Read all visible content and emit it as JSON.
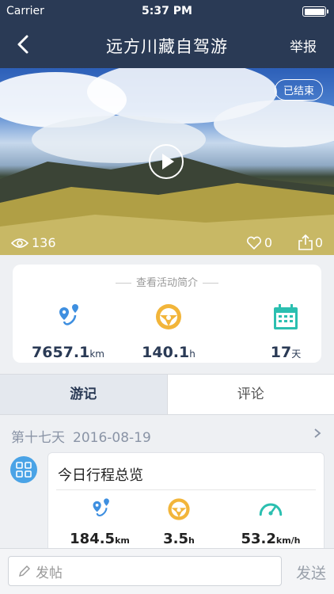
{
  "status": {
    "carrier": "Carrier",
    "time": "5:37 PM"
  },
  "nav": {
    "title": "远方川藏自驾游",
    "report": "举报"
  },
  "hero": {
    "badge": "已结束",
    "views": "136",
    "likes": "0",
    "shares": "0"
  },
  "summary": {
    "heading": "查看活动简介",
    "distance": {
      "value": "7657.1",
      "unit": "km",
      "icon": "route-icon"
    },
    "duration": {
      "value": "140.1",
      "unit": "h",
      "icon": "steering-wheel-icon"
    },
    "days": {
      "value": "17",
      "unit": "天",
      "icon": "calendar-icon"
    }
  },
  "tabs": {
    "journal": "游记",
    "comments": "评论"
  },
  "day": {
    "label": "第十七天",
    "date": "2016-08-19"
  },
  "overview": {
    "title": "今日行程总览",
    "distance": {
      "value": "184.5",
      "unit": "km"
    },
    "duration": {
      "value": "3.5",
      "unit": "h"
    },
    "speed": {
      "value": "53.2",
      "unit": "km/h"
    }
  },
  "composer": {
    "placeholder": "发帖",
    "send": "发送"
  },
  "colors": {
    "nav": "#2a3a55",
    "blue": "#3e8fe0",
    "yellow": "#f2b53a",
    "teal": "#2bbfb0"
  }
}
